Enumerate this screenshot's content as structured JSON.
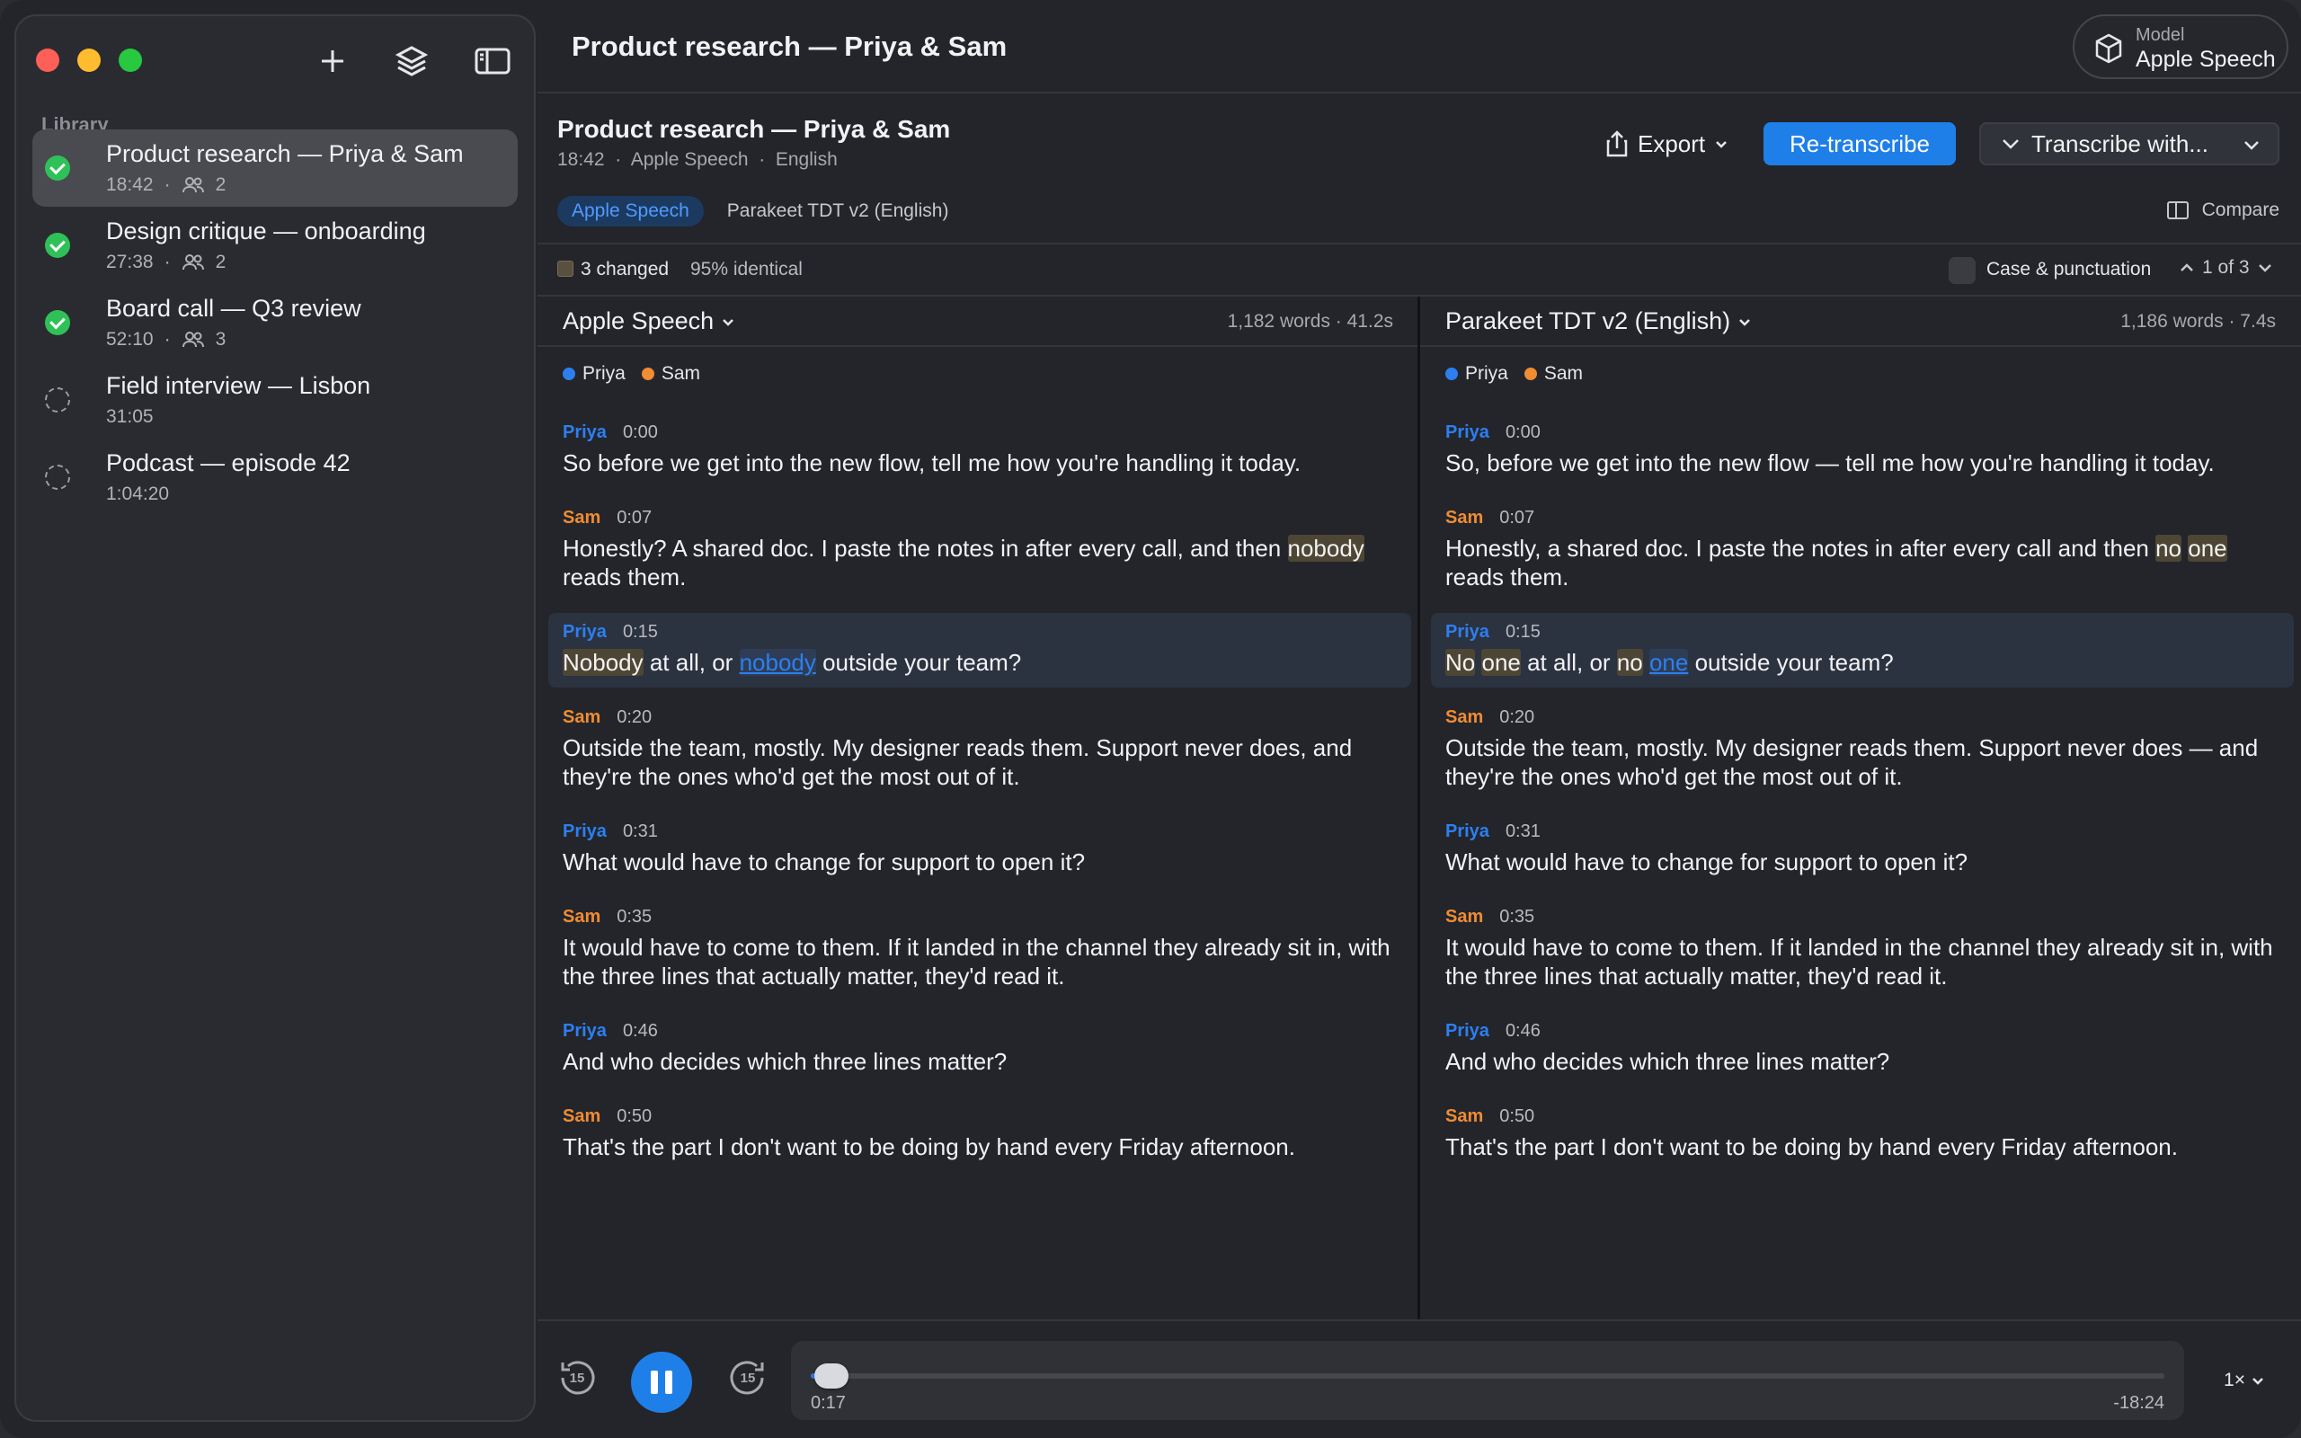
{
  "window": {
    "title": "Product research — Priya & Sam"
  },
  "model": {
    "label": "Model",
    "value": "Apple Speech"
  },
  "sidebar": {
    "section_label": "Library",
    "items": [
      {
        "title": "Product research — Priya & Sam",
        "duration": "18:42",
        "speakers": "2",
        "status": "done",
        "active": true
      },
      {
        "title": "Design critique — onboarding",
        "duration": "27:38",
        "speakers": "2",
        "status": "done",
        "active": false
      },
      {
        "title": "Board call — Q3 review",
        "duration": "52:10",
        "speakers": "3",
        "status": "done",
        "active": false
      },
      {
        "title": "Field interview — Lisbon",
        "duration": "31:05",
        "speakers": "",
        "status": "pending",
        "active": false
      },
      {
        "title": "Podcast — episode 42",
        "duration": "1:04:20",
        "speakers": "",
        "status": "pending",
        "active": false
      }
    ]
  },
  "doc": {
    "title": "Product research — Priya & Sam",
    "duration": "18:42",
    "engine": "Apple Speech",
    "language": "English",
    "separator": "·"
  },
  "toolbar": {
    "export_label": "Export",
    "retranscribe_label": "Re-transcribe",
    "transcribe_with_label": "Transcribe with...",
    "compare_label": "Compare"
  },
  "tabs": [
    {
      "label": "Apple Speech",
      "active": true
    },
    {
      "label": "Parakeet TDT v2 (English)",
      "active": false
    }
  ],
  "diff": {
    "changed_label": "3 changed",
    "identical_label": "95% identical",
    "case_label": "Case & punctuation",
    "nav_label": "1 of 3"
  },
  "legend": [
    {
      "name": "Priya",
      "color": "#2d7ff0"
    },
    {
      "name": "Sam",
      "color": "#f08c32"
    }
  ],
  "panes": [
    {
      "name": "Apple Speech",
      "stats": "1,182 words · 41.2s",
      "segments": [
        {
          "speaker": "Priya",
          "time": "0:00",
          "parts": [
            {
              "t": "So before we get into the new flow, tell me how you're handling it today."
            }
          ]
        },
        {
          "speaker": "Sam",
          "time": "0:07",
          "parts": [
            {
              "t": "Honestly? A shared doc. I paste the notes in after every call, and then "
            },
            {
              "t": "nobody",
              "hl": "change"
            },
            {
              "t": " reads them."
            }
          ]
        },
        {
          "speaker": "Priya",
          "time": "0:15",
          "current": true,
          "parts": [
            {
              "t": "Nobody",
              "hl": "change"
            },
            {
              "t": " at all, or "
            },
            {
              "t": "nobody",
              "hl": "link"
            },
            {
              "t": " outside your team?"
            }
          ]
        },
        {
          "speaker": "Sam",
          "time": "0:20",
          "parts": [
            {
              "t": "Outside the team, mostly. My designer reads them. Support never does, and they're the ones who'd get the most out of it."
            }
          ]
        },
        {
          "speaker": "Priya",
          "time": "0:31",
          "parts": [
            {
              "t": "What would have to change for support to open it?"
            }
          ]
        },
        {
          "speaker": "Sam",
          "time": "0:35",
          "parts": [
            {
              "t": "It would have to come to them. If it landed in the channel they already sit in, with the three lines that actually matter, they'd read it."
            }
          ]
        },
        {
          "speaker": "Priya",
          "time": "0:46",
          "parts": [
            {
              "t": "And who decides which three lines matter?"
            }
          ]
        },
        {
          "speaker": "Sam",
          "time": "0:50",
          "parts": [
            {
              "t": "That's the part I don't want to be doing by hand every Friday afternoon."
            }
          ]
        }
      ]
    },
    {
      "name": "Parakeet TDT v2 (English)",
      "stats": "1,186 words · 7.4s",
      "segments": [
        {
          "speaker": "Priya",
          "time": "0:00",
          "parts": [
            {
              "t": "So, before we get into the new flow — tell me how you're handling it today."
            }
          ]
        },
        {
          "speaker": "Sam",
          "time": "0:07",
          "parts": [
            {
              "t": "Honestly, a shared doc. I paste the notes in after every call and then "
            },
            {
              "t": "no",
              "hl": "change"
            },
            {
              "t": " "
            },
            {
              "t": "one",
              "hl": "change"
            },
            {
              "t": " reads them."
            }
          ]
        },
        {
          "speaker": "Priya",
          "time": "0:15",
          "current": true,
          "parts": [
            {
              "t": "No",
              "hl": "change"
            },
            {
              "t": " "
            },
            {
              "t": "one",
              "hl": "change"
            },
            {
              "t": " at all, or "
            },
            {
              "t": "no",
              "hl": "change"
            },
            {
              "t": " "
            },
            {
              "t": "one",
              "hl": "link"
            },
            {
              "t": " outside your team?"
            }
          ]
        },
        {
          "speaker": "Sam",
          "time": "0:20",
          "parts": [
            {
              "t": "Outside the team, mostly. My designer reads them. Support never does — and they're the ones who'd get the most out of it."
            }
          ]
        },
        {
          "speaker": "Priya",
          "time": "0:31",
          "parts": [
            {
              "t": "What would have to change for support to open it?"
            }
          ]
        },
        {
          "speaker": "Sam",
          "time": "0:35",
          "parts": [
            {
              "t": "It would have to come to them. If it landed in the channel they already sit in, with the three lines that actually matter, they'd read it."
            }
          ]
        },
        {
          "speaker": "Priya",
          "time": "0:46",
          "parts": [
            {
              "t": "And who decides which three lines matter?"
            }
          ]
        },
        {
          "speaker": "Sam",
          "time": "0:50",
          "parts": [
            {
              "t": "That's the part I don't want to be doing by hand every Friday afternoon."
            }
          ]
        }
      ]
    }
  ],
  "player": {
    "skip_back_label": "15",
    "skip_forward_label": "15",
    "elapsed": "0:17",
    "remaining": "-18:24",
    "progress_fraction": 0.015,
    "speed": "1×",
    "state": "playing"
  },
  "colors": {
    "accent": "#1f7fe8",
    "priya": "#2d7ff0",
    "sam": "#f08c32",
    "success": "#2fc158"
  }
}
